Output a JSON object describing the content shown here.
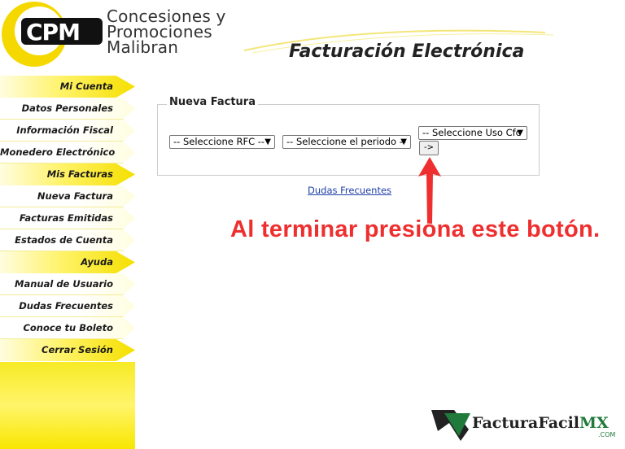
{
  "brand": {
    "logo_letters": "CPM",
    "name_line1": "Concesiones y",
    "name_line2": "Promociones",
    "name_line3": "Malibran"
  },
  "header": {
    "title": "Facturación Electrónica"
  },
  "sidebar": {
    "items": [
      {
        "label": "Mi Cuenta",
        "type": "section"
      },
      {
        "label": "Datos Personales",
        "type": "link"
      },
      {
        "label": "Información Fiscal",
        "type": "link"
      },
      {
        "label": "Monedero Electrónico",
        "type": "link"
      },
      {
        "label": "Mis Facturas",
        "type": "section"
      },
      {
        "label": "Nueva Factura",
        "type": "link"
      },
      {
        "label": "Facturas Emitidas",
        "type": "link"
      },
      {
        "label": "Estados de Cuenta",
        "type": "link"
      },
      {
        "label": "Ayuda",
        "type": "section"
      },
      {
        "label": "Manual de Usuario",
        "type": "link"
      },
      {
        "label": "Dudas Frecuentes",
        "type": "link"
      },
      {
        "label": "Conoce tu Boleto",
        "type": "link"
      },
      {
        "label": "Cerrar Sesión",
        "type": "section"
      }
    ]
  },
  "form": {
    "legend": "Nueva Factura",
    "rfc_select": "-- Seleccione RFC --",
    "period_select": "-- Seleccione el periodo --",
    "uso_select": "-- Seleccione Uso Cfc",
    "submit_label": "->",
    "faq_link": "Dudas Frecuentes"
  },
  "annotation": {
    "text": "Al terminar presiona este botón."
  },
  "watermark": {
    "text_main": "FacturaFacil",
    "text_accent": "MX",
    "text_com": ".COM"
  },
  "colors": {
    "accent_yellow": "#f5df00",
    "annotation_red": "#ef2f2f",
    "link_blue": "#1f3fa8",
    "watermark_green": "#1f7a3b"
  }
}
